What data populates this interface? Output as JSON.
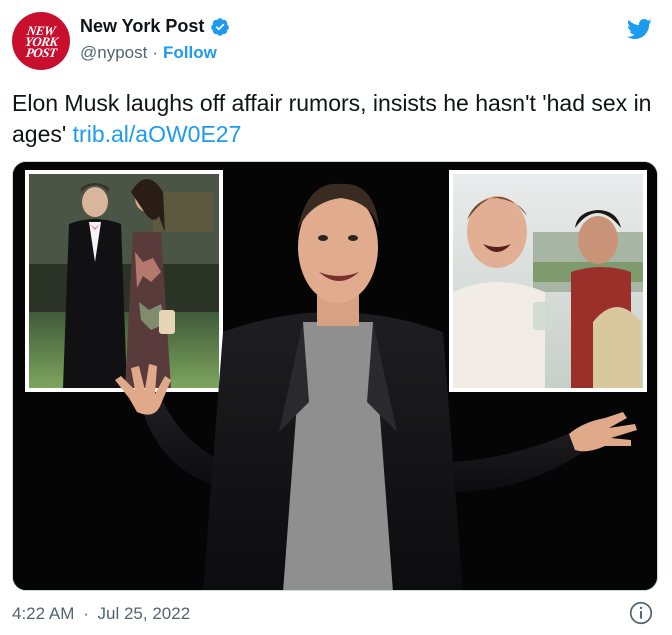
{
  "account": {
    "display_name": "New York Post",
    "handle": "@nypost",
    "separator": "·",
    "follow_label": "Follow",
    "avatar_lines": [
      "NEW",
      "YORK",
      "POST"
    ]
  },
  "tweet": {
    "text": "Elon Musk laughs off affair rumors, insists he hasn't 'had sex in ages' ",
    "link": "trib.al/aOW0E27",
    "time": "4:22 AM",
    "separator": "·",
    "date": "Jul 25, 2022"
  },
  "icons": {
    "verified": "verified-badge-icon",
    "twitter": "twitter-bird-icon",
    "info": "info-icon"
  },
  "colors": {
    "accent": "#1d9bf0",
    "brand_red": "#c8102e",
    "text_primary": "#0f1419",
    "text_secondary": "#536471"
  }
}
